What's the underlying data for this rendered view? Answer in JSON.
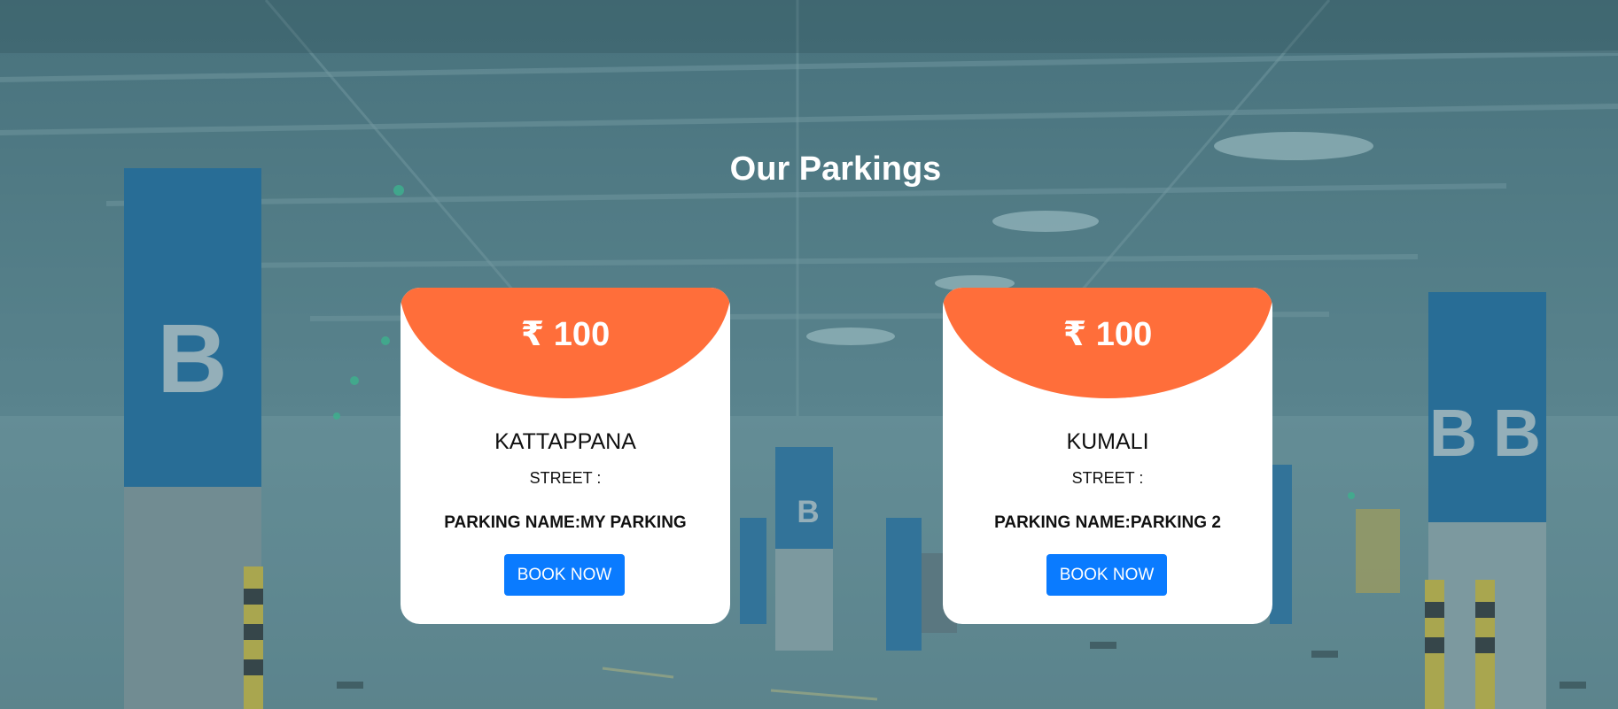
{
  "section": {
    "title": "Our Parkings"
  },
  "colors": {
    "accent": "#ff6e3a",
    "button": "#0a7bff",
    "overlay": "#5f8a94"
  },
  "background": {
    "pillar_letter": "B"
  },
  "cards": [
    {
      "price": "₹ 100",
      "city": "KATTAPPANA",
      "street": "STREET :",
      "parking_name": "PARKING NAME:MY PARKING",
      "button_label": "BOOK NOW"
    },
    {
      "price": "₹ 100",
      "city": "KUMALI",
      "street": "STREET :",
      "parking_name": "PARKING NAME:PARKING 2",
      "button_label": "BOOK NOW"
    }
  ]
}
